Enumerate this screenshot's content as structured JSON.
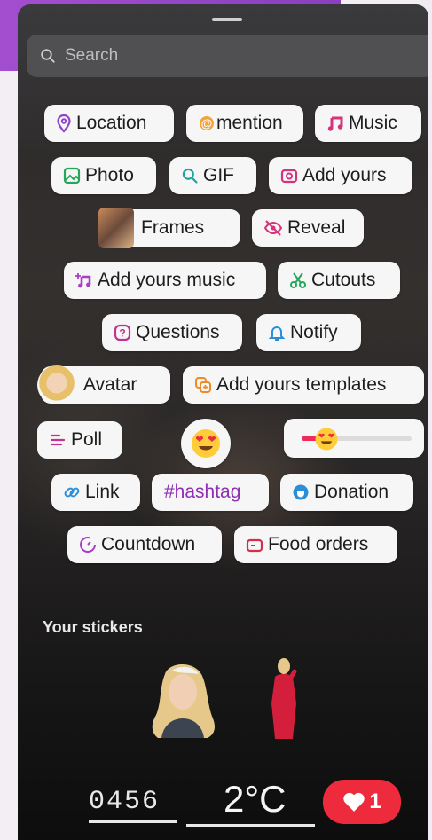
{
  "search": {
    "placeholder": "Search"
  },
  "stickers": {
    "location": "Location",
    "mention": "mention",
    "music": "Music",
    "photo": "Photo",
    "gif": "GIF",
    "add_yours": "Add yours",
    "frames": "Frames",
    "reveal": "Reveal",
    "add_yours_music": "Add yours music",
    "cutouts": "Cutouts",
    "questions": "Questions",
    "notify": "Notify",
    "avatar": "Avatar",
    "add_yours_templates": "Add yours templates",
    "poll": "Poll",
    "link": "Link",
    "hashtag": "#hashtag",
    "donation": "Donation",
    "countdown": "Countdown",
    "food_orders": "Food orders"
  },
  "your_stickers": {
    "title": "Your stickers"
  },
  "bottom": {
    "time": "0456",
    "temp": "2°C",
    "likes": "1"
  },
  "colors": {
    "accent_pink": "#d6337c",
    "accent_purple": "#8a3fc1",
    "heart_red": "#ee2b3d"
  }
}
